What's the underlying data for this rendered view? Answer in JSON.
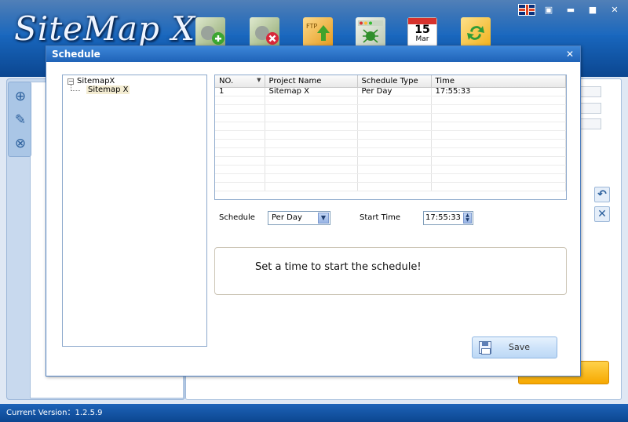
{
  "app": {
    "logo_text": "SiteMap X",
    "toolbar_icons": [
      "new-project-icon",
      "delete-project-icon",
      "ftp-upload-icon",
      "spider-crawl-icon",
      "schedule-calendar-icon",
      "update-icon"
    ],
    "calendar": {
      "day": "15",
      "month": "Mar"
    },
    "window_controls": [
      "flag-icon",
      "restore-icon",
      "minimize-icon",
      "maximize-icon",
      "close-icon"
    ],
    "status": "Current Version：1.2.5.9"
  },
  "dialog": {
    "title": "Schedule",
    "tree": {
      "root": "SitemapX",
      "child": "Sitemap X"
    },
    "grid": {
      "columns": [
        "NO.",
        "Project Name",
        "Schedule Type",
        "Time"
      ],
      "rows": [
        [
          "1",
          "Sitemap X",
          "Per Day",
          "17:55:33"
        ]
      ]
    },
    "schedule_label": "Schedule",
    "schedule_value": "Per Day",
    "start_time_label": "Start Time",
    "start_time_value": "17:55:33",
    "message": "Set a time to start the schedule!",
    "save_label": "Save"
  },
  "colors": {
    "header_blue": "#1967be",
    "title_blue": "#2a72c8",
    "accent_orange": "#f6a800"
  }
}
